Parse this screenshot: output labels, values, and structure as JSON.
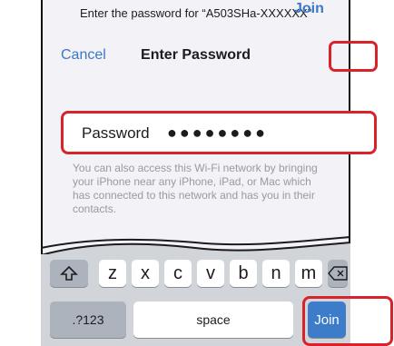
{
  "dialog": {
    "prompt": "Enter the password for “A503SHa-XXXXXX”",
    "cancel_label": "Cancel",
    "title": "Enter Password",
    "join_label": "Join"
  },
  "password_field": {
    "label": "Password",
    "value": "●●●●●●●●"
  },
  "hint": "You can also access this Wi-Fi network by bringing your iPhone near any iPhone, iPad, or Mac which has connected to this network and has you in their contacts.",
  "keyboard": {
    "letters": [
      "z",
      "x",
      "c",
      "v",
      "b",
      "n",
      "m"
    ],
    "shift_icon": "shift-icon",
    "delete_icon": "delete-icon",
    "numbers_label": ".?123",
    "space_label": "space",
    "join_label": "Join"
  },
  "colors": {
    "accent": "#3a79c8",
    "highlight": "#d9232b",
    "join_key": "#3d7cc9"
  }
}
